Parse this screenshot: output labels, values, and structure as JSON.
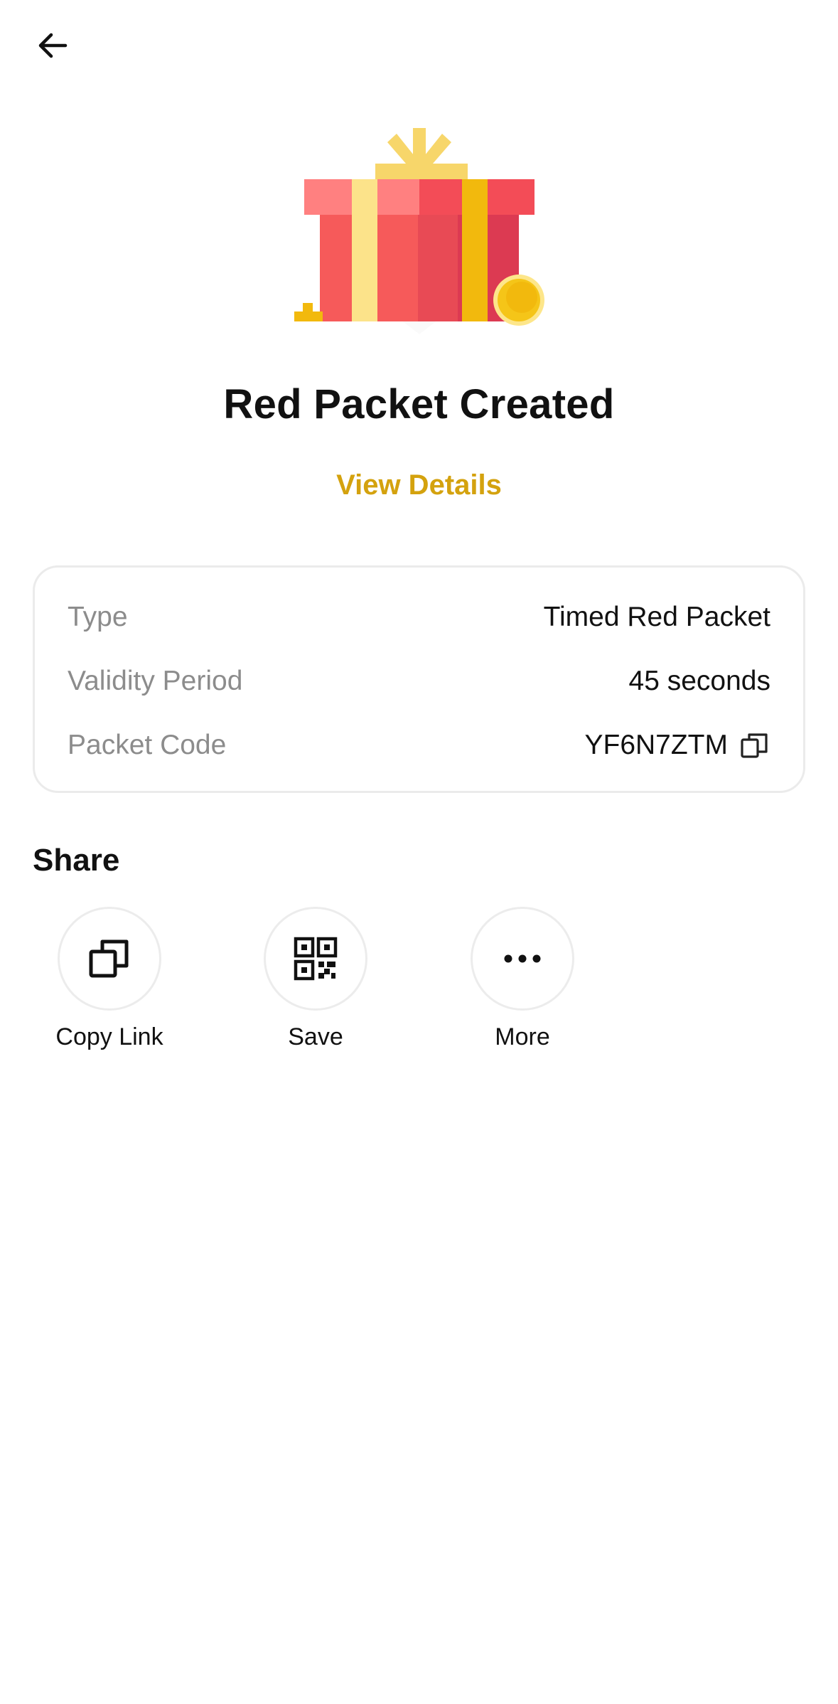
{
  "header": {
    "back_icon": "arrow-left-icon"
  },
  "illustration": {
    "name": "gift-box-illustration",
    "colors": {
      "box_red": "#f65a5a",
      "box_dark": "#dc3a52",
      "ribbon_light": "#fce38a",
      "ribbon_gold": "#f2b90d",
      "coin": "#f5c518"
    }
  },
  "title": "Red Packet Created",
  "view_details_label": "View Details",
  "details": {
    "rows": [
      {
        "label": "Type",
        "value": "Timed Red Packet"
      },
      {
        "label": "Validity Period",
        "value": "45 seconds"
      },
      {
        "label": "Packet Code",
        "value": "YF6N7ZTM"
      }
    ],
    "copy_icon": "copy-icon"
  },
  "share": {
    "heading": "Share",
    "options": [
      {
        "label": "Copy Link",
        "icon": "copy-link-icon"
      },
      {
        "label": "Save",
        "icon": "qr-code-icon"
      },
      {
        "label": "More",
        "icon": "more-dots-icon"
      }
    ]
  },
  "colors": {
    "accent": "#d4a20e",
    "label_gray": "#8c8c8c",
    "card_border": "#ebebeb"
  }
}
